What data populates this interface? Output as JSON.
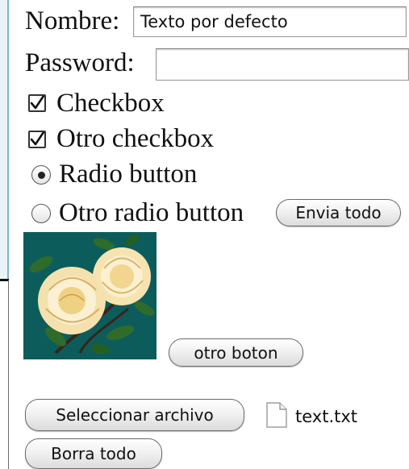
{
  "form": {
    "nombre_label": "Nombre:",
    "nombre_value": "Texto por defecto",
    "password_label": "Password:",
    "password_value": "",
    "checkbox1_label": "Checkbox",
    "checkbox2_label": "Otro checkbox",
    "radio1_label": "Radio button",
    "radio2_label": "Otro radio button",
    "submit_label": "Envia todo",
    "image_button_label": "otro boton",
    "file_button_label": "Seleccionar archivo",
    "file_name": "text.txt",
    "reset_label": "Borra todo"
  },
  "state": {
    "checkbox1_checked": true,
    "checkbox2_checked": true,
    "radio_selected": "radio1"
  },
  "icons": {
    "check": "check-icon",
    "file": "file-icon"
  },
  "colors": {
    "image_background": "#0d5c5c",
    "edge_accent": "#7fb2cf"
  }
}
